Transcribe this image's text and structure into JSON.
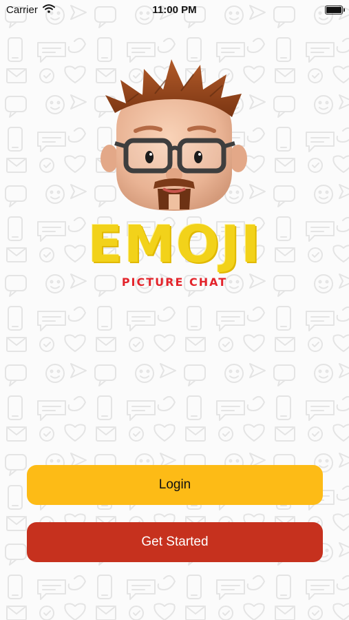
{
  "status_bar": {
    "carrier": "Carrier",
    "time": "11:00 PM"
  },
  "logo": {
    "title": "EMOJI",
    "subtitle": "Picture Chat"
  },
  "buttons": {
    "login_label": "Login",
    "get_started_label": "Get Started"
  },
  "colors": {
    "background": "#fbfbfb",
    "doodle": "#e6e6e6",
    "title_yellow": "#f2d21a",
    "subtitle_red": "#e3242b",
    "login_button": "#fdbb16",
    "get_started_button": "#c6311e"
  },
  "icons": [
    "wifi-icon",
    "battery-icon",
    "avatar-emoji-glasses-beard",
    "chat-doodle-pattern"
  ]
}
